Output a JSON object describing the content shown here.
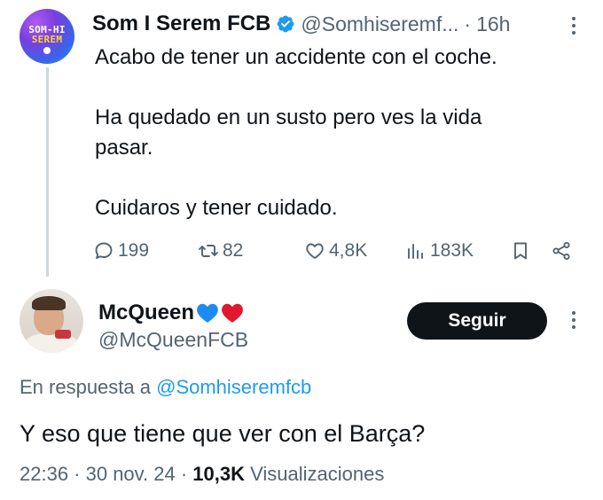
{
  "parent_tweet": {
    "avatar_logo_line1": "SOM-HI",
    "avatar_logo_line2": "SEREM",
    "display_name": "Som I Serem FCB",
    "handle": "@Somhiseremf...",
    "separator": "·",
    "time": "16h",
    "text_lines": [
      "Acabo de tener un accidente con el coche.",
      "Ha quedado en un susto pero ves la vida",
      "pasar.",
      "Cuidaros y tener cuidado."
    ],
    "actions": {
      "replies": "199",
      "retweets": "82",
      "likes": "4,8K",
      "views": "183K"
    },
    "icons": {
      "verified": "verified-badge-icon",
      "more": "more-vertical-icon",
      "reply": "reply-bubble-icon",
      "retweet": "retweet-icon",
      "like": "heart-outline-icon",
      "views": "views-bar-chart-icon",
      "bookmark": "bookmark-icon",
      "share": "share-icon"
    }
  },
  "reply_tweet": {
    "display_name": "McQueen",
    "name_emojis": [
      "blue-heart",
      "red-heart"
    ],
    "handle": "@McQueenFCB",
    "follow_label": "Seguir",
    "in_reply_prefix": "En respuesta a",
    "in_reply_mention": "@Somhiseremfcb",
    "text": "Y eso que tiene que ver con el Barça?",
    "timestamp": "22:36 · 30 nov. 24 ·",
    "views_count": "10,3K",
    "views_label": "Visualizaciones"
  },
  "colors": {
    "text_primary": "#0f1419",
    "text_secondary": "#536471",
    "accent_blue": "#1d9bf0",
    "button_dark": "#0f1419",
    "thread_line": "#cfd9de",
    "heart_blue": "#1d8cf0",
    "heart_red": "#e0192e"
  }
}
